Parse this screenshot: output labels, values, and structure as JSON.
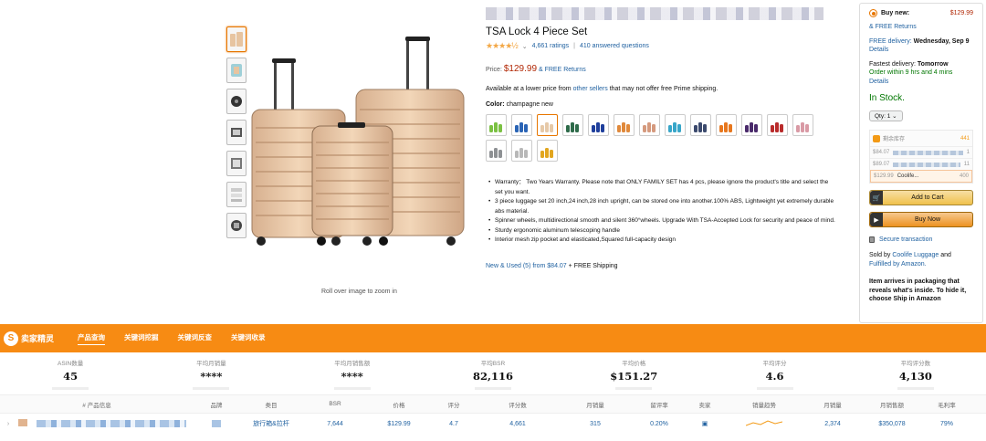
{
  "product": {
    "title": "TSA Lock 4 Piece Set",
    "rating_count": "4,661 ratings",
    "answered": "410 answered questions",
    "price_label": "Price:",
    "price": "$129.99",
    "free_returns": "& FREE Returns",
    "availability_prefix": "Available at a lower price from",
    "availability_link": "other sellers",
    "availability_suffix": "that may not offer free Prime shipping.",
    "color_label": "Color:",
    "color_value": "champagne new",
    "zoom_hint": "Roll over image to zoom in",
    "new_used": "New & Used (5) from $84.07",
    "new_used_suffix": "+ FREE Shipping",
    "bullets": [
      "Warranty： Two Years Warranty. Please note that ONLY FAMILY SET has 4 pcs, please ignore the product's title and select the set you want.",
      "3 piece luggage set 20 inch,24 inch,28 inch upright, can be stored one into another.100% ABS, Lightweight yet extremely durable abs material.",
      "Spinner wheels, multidirectional smooth and silent 360°wheels. Upgrade With TSA-Accepted Lock for security and peace of mind.",
      "Sturdy ergonomic aluminum telescoping handle",
      "Interior mesh zip pocket and elasticated,Squared full-capacity design"
    ],
    "swatch_colors": [
      [
        "#7bc143"
      ],
      [
        "#2a64b5"
      ],
      [
        "#e6c9a8"
      ],
      [
        "#2e6b4a"
      ],
      [
        "#1f3f9c"
      ],
      [
        "#e0893b"
      ],
      [
        "#d59a7e"
      ],
      [
        "#38a6c9"
      ],
      [
        "#3c4a6e"
      ],
      [
        "#e7771e"
      ],
      [
        "#4a2a6b"
      ],
      [
        "#b92b2b"
      ],
      [
        "#d99aa5"
      ],
      [
        "#8e9194"
      ],
      [
        "#b8b8b8"
      ],
      [
        "#e2a61f"
      ]
    ]
  },
  "buybox": {
    "buy_new": "Buy new:",
    "price": "$129.99",
    "free_returns": "& FREE Returns",
    "delivery_prefix": "FREE delivery:",
    "delivery_date": "Wednesday, Sep 9",
    "details": "Details",
    "fastest_prefix": "Fastest delivery:",
    "fastest_day": "Tomorrow",
    "order_within": "Order within 9 hrs and 4 mins",
    "in_stock": "In Stock.",
    "qty": "Qty: 1",
    "sellers_header": "剩余库存",
    "sellers_count": "441",
    "sellers": [
      {
        "price": "$84.07",
        "qty": "1"
      },
      {
        "price": "$89.07",
        "qty": "11"
      },
      {
        "price": "$129.99",
        "name": "Coolife...",
        "qty": "400"
      }
    ],
    "add_to_cart": "Add to Cart",
    "buy_now": "Buy Now",
    "secure": "Secure transaction",
    "sold_by_prefix": "Sold by",
    "sold_by_link": "Coolife Luggage",
    "sold_by_mid": "and",
    "fulfilled_link": "Fulfilled by Amazon.",
    "packaging": "Item arrives in packaging that reveals what's inside. To hide it, choose Ship in Amazon"
  },
  "plugin": {
    "logo": "卖家精灵",
    "tabs": [
      "产品查询",
      "关键词挖掘",
      "关键词反查",
      "关键词收录"
    ],
    "stats": [
      {
        "label": "ASIN数量",
        "value": "45"
      },
      {
        "label": "平均月销量",
        "value": "****"
      },
      {
        "label": "平均月销售额",
        "value": "****"
      },
      {
        "label": "平均BSR",
        "value": "82,116"
      },
      {
        "label": "平均价格",
        "value": "$151.27"
      },
      {
        "label": "平均评分",
        "value": "4.6"
      },
      {
        "label": "平均评分数",
        "value": "4,130"
      }
    ],
    "columns": [
      "# 产品信息",
      "品牌",
      "类目",
      "BSR",
      "价格",
      "评分",
      "评分数",
      "月销量",
      "留评率",
      "卖家",
      "销量趋势",
      "月销量",
      "月销售额",
      "毛利率"
    ],
    "row": {
      "brand_cat": "旅行箱&拉杆",
      "bsr": "7,644",
      "price": "$129.99",
      "rating": "4.7",
      "ratings": "4,661",
      "monthly": "315",
      "rate": "0.20%",
      "sales": "2,374",
      "revenue": "$350,078",
      "margin": "79%"
    }
  }
}
